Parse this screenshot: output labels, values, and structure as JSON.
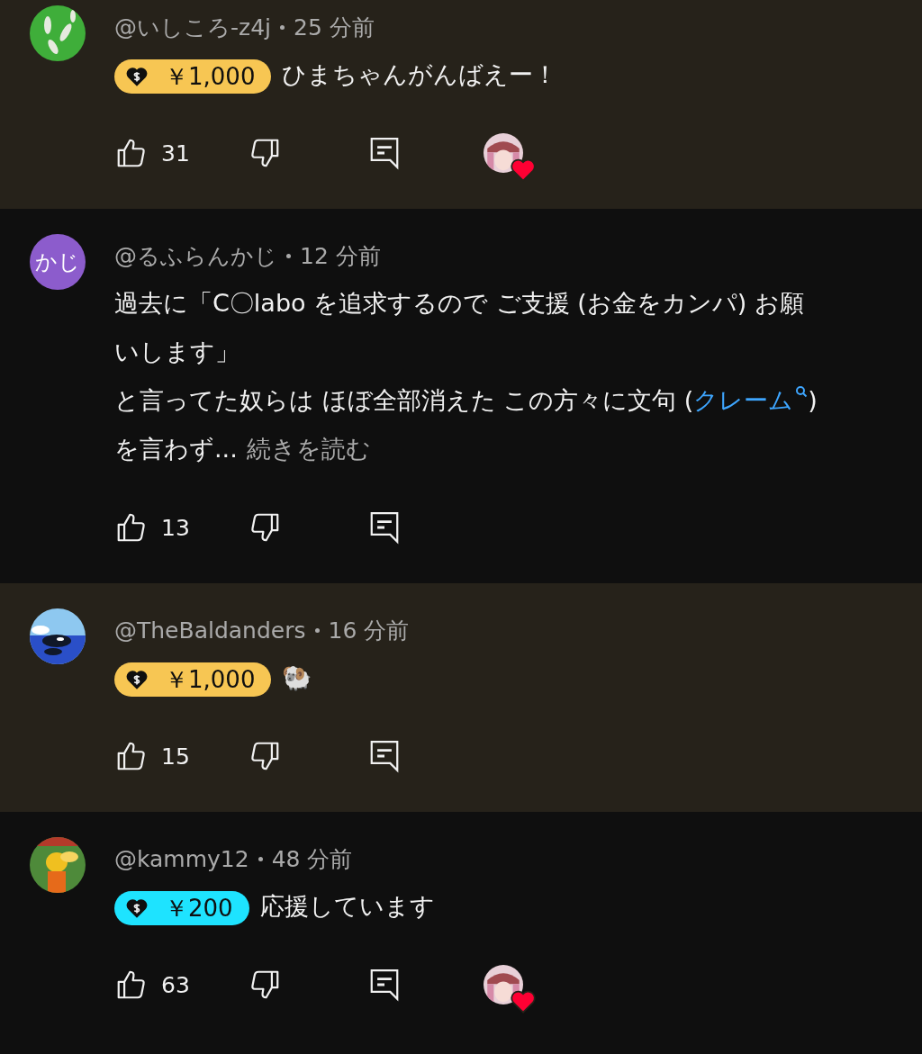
{
  "comments": [
    {
      "highlighted": true,
      "author": "@いしころ-z4j",
      "time": "25 分前",
      "avatar": {
        "kind": "picture"
      },
      "super_thanks": {
        "amount": "￥1,000",
        "color": "#f7c653"
      },
      "body": [
        {
          "parts": [
            {
              "text": "ひまちゃんがんばえー！"
            }
          ]
        }
      ],
      "likes": "31",
      "hearted": true
    },
    {
      "highlighted": false,
      "author": "@るふらんかじ",
      "time": "12 分前",
      "avatar": {
        "kind": "initials",
        "initials": "かじ",
        "color": "#8c5ccc"
      },
      "body": [
        {
          "parts": [
            {
              "text": "過去に「C〇labo を追求するので ご支援 (お金をカンパ) お願いします」"
            }
          ]
        },
        {
          "parts": [
            {
              "text": "と言ってた奴らは ほぼ全部消えた この方々に文句 ("
            },
            {
              "link": "クレーム"
            },
            {
              "text": ") を言わず..."
            }
          ],
          "read_more": "続きを読む"
        }
      ],
      "likes": "13",
      "hearted": false
    },
    {
      "highlighted": true,
      "author": "@TheBaldanders",
      "time": "16 分前",
      "avatar": {
        "kind": "picture"
      },
      "super_thanks": {
        "amount": "￥1,000",
        "color": "#f7c653"
      },
      "body": [
        {
          "parts": [
            {
              "text": "🐏"
            }
          ]
        }
      ],
      "likes": "15",
      "hearted": false
    },
    {
      "highlighted": false,
      "author": "@kammy12",
      "time": "48 分前",
      "avatar": {
        "kind": "picture"
      },
      "super_thanks": {
        "amount": "￥200",
        "color": "#1ee3ff"
      },
      "body": [
        {
          "parts": [
            {
              "text": "応援しています"
            }
          ]
        }
      ],
      "likes": "63",
      "hearted": true
    }
  ]
}
